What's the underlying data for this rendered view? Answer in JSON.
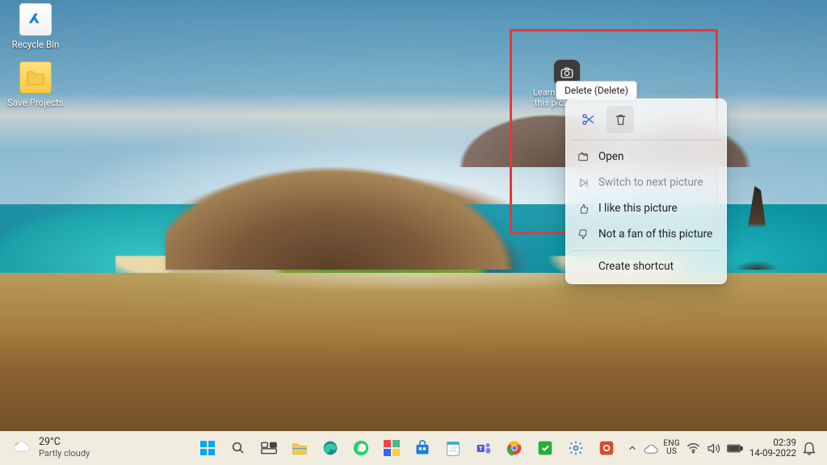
{
  "desktop": {
    "icons": [
      {
        "name": "recycle-bin",
        "label": "Recycle Bin"
      },
      {
        "name": "save-projects",
        "label": "Save Projects"
      }
    ],
    "spotlight_label": "Learn about this picture"
  },
  "tooltip": {
    "text": "Delete (Delete)"
  },
  "context_menu": {
    "iconbar": [
      {
        "name": "cut-icon"
      },
      {
        "name": "delete-icon"
      }
    ],
    "items": [
      {
        "icon": "open-icon",
        "label": "Open",
        "disabled": false
      },
      {
        "icon": "next-icon",
        "label": "Switch to next picture",
        "disabled": true
      },
      {
        "icon": "like-icon",
        "label": "I like this picture",
        "disabled": false
      },
      {
        "icon": "dislike-icon",
        "label": "Not a fan of this picture",
        "disabled": false
      },
      {
        "icon": null,
        "label": "Create shortcut",
        "disabled": false
      }
    ]
  },
  "taskbar": {
    "weather": {
      "temp": "29°C",
      "desc": "Partly cloudy"
    },
    "apps": [
      {
        "name": "start"
      },
      {
        "name": "search"
      },
      {
        "name": "task-view"
      },
      {
        "name": "explorer"
      },
      {
        "name": "edge"
      },
      {
        "name": "whatsapp"
      },
      {
        "name": "rainbow"
      },
      {
        "name": "store"
      },
      {
        "name": "notepad"
      },
      {
        "name": "teams"
      },
      {
        "name": "chrome"
      },
      {
        "name": "green-app"
      },
      {
        "name": "settings"
      },
      {
        "name": "red-app"
      }
    ],
    "tray": {
      "lang_top": "ENG",
      "lang_bot": "US",
      "time": "02:39",
      "date": "14-09-2022"
    }
  }
}
